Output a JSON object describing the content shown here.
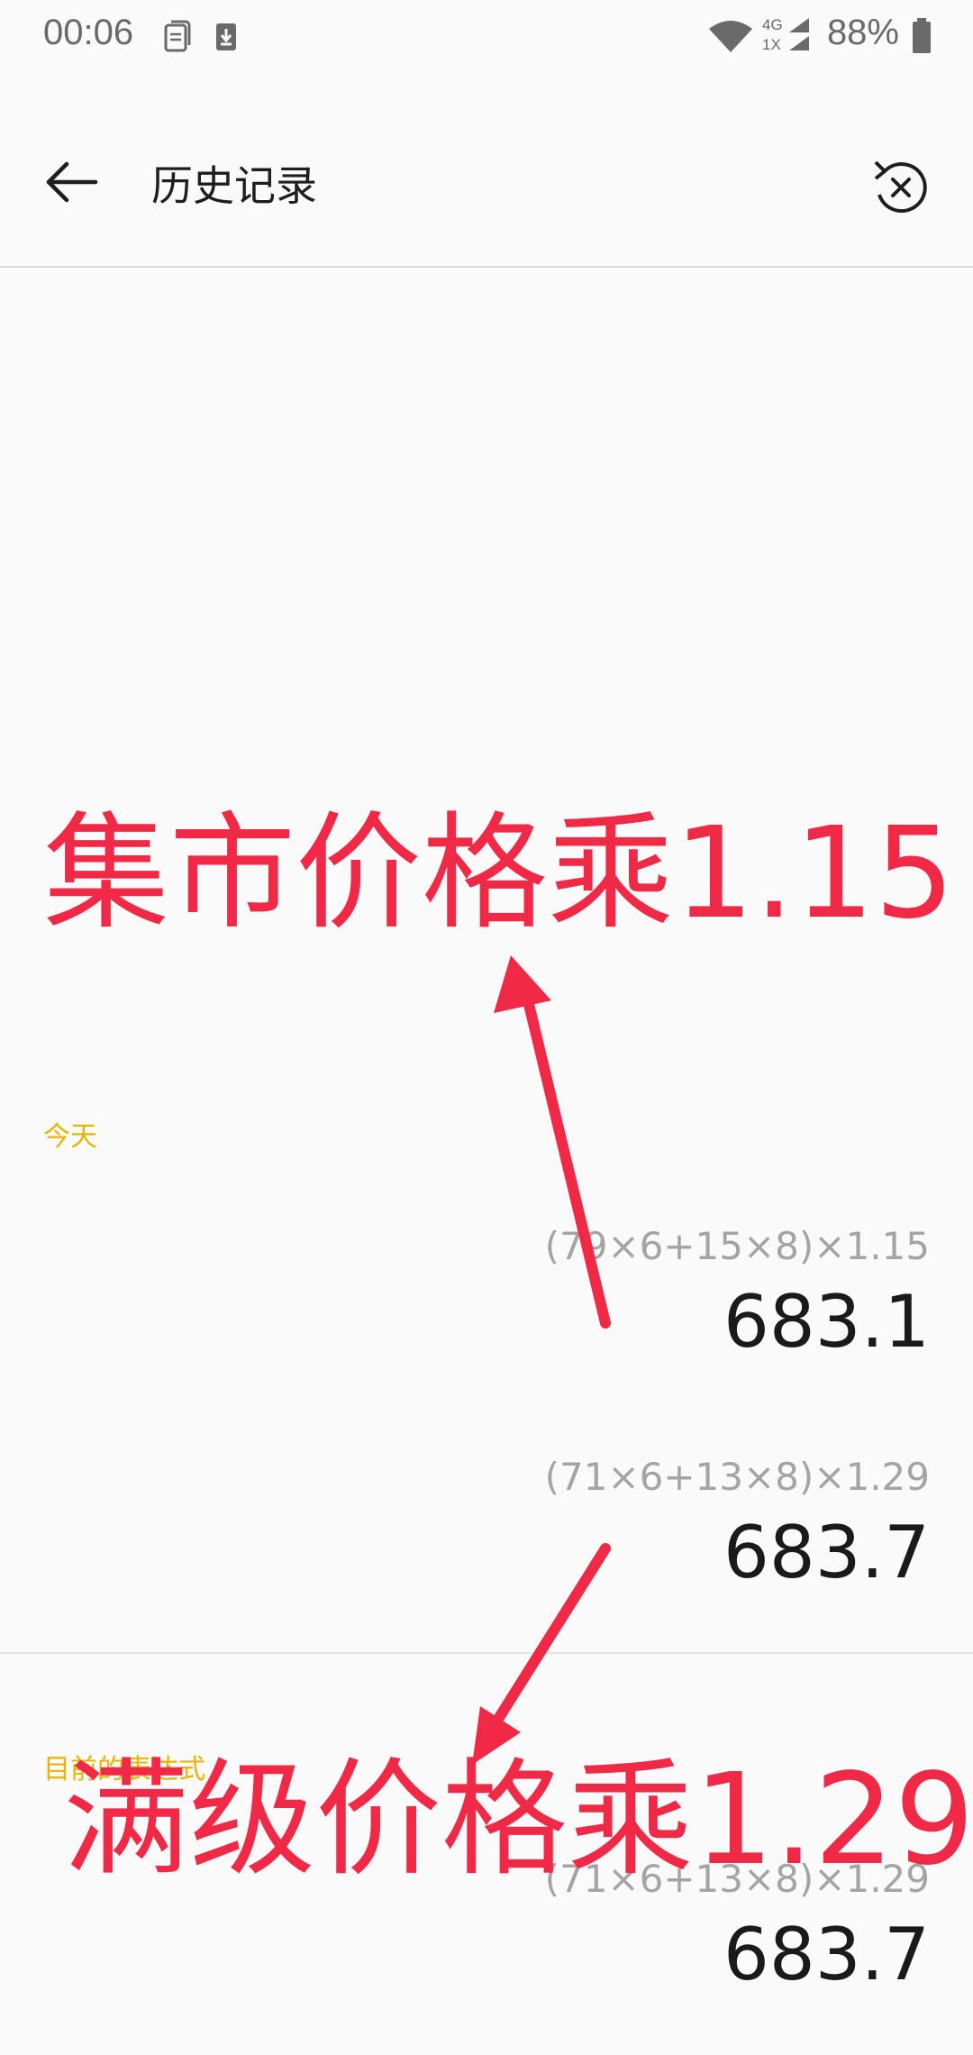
{
  "status_bar": {
    "time": "00:06",
    "network": "4G",
    "network_secondary": "1X",
    "battery": "88%"
  },
  "toolbar": {
    "title": "历史记录",
    "back_icon": "arrow-left-icon",
    "clear_icon": "clear-history-icon"
  },
  "sections": {
    "today_label": "今天",
    "current_label": "目前的表达式"
  },
  "history": [
    {
      "expression": "(79×6+15×8)×1.15",
      "result": "683.1"
    },
    {
      "expression": "(71×6+13×8)×1.29",
      "result": "683.7"
    }
  ],
  "current": {
    "expression": "(71×6+13×8)×1.29",
    "result": "683.7"
  },
  "annotations": {
    "top_text": "集市价格乘1.15",
    "bottom_text": "满级价格乘1.29",
    "color": "#ef2946"
  },
  "colors": {
    "accent_label": "#e8b400",
    "annotation": "#ef2946"
  }
}
